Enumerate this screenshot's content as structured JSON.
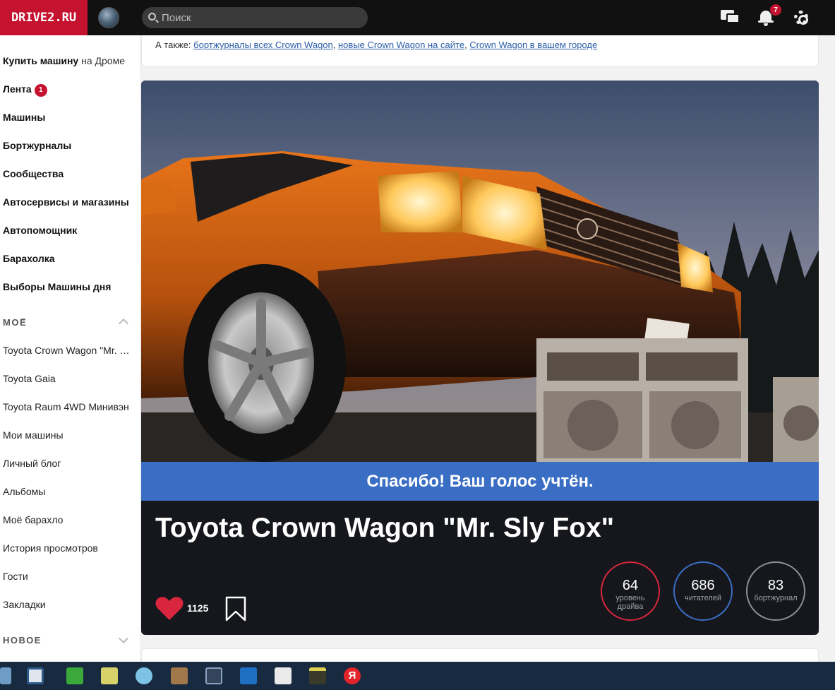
{
  "topbar": {
    "logo": "DRIVE2.RU",
    "search_placeholder": "Поиск",
    "notifications_count": "7"
  },
  "sidebar": {
    "main_nav": [
      {
        "label": "Купить машину",
        "suffix": " на Дроме"
      },
      {
        "label": "Лента",
        "badge": "1"
      },
      {
        "label": "Машины"
      },
      {
        "label": "Бортжурналы"
      },
      {
        "label": "Сообщества"
      },
      {
        "label": "Автосервисы и магазины"
      },
      {
        "label": "Автопомощник"
      },
      {
        "label": "Барахолка"
      },
      {
        "label": "Выборы Машины дня"
      }
    ],
    "my_section_title": "МОЁ",
    "my_items": [
      "Toyota Crown Wagon \"Mr. Sly Fox\"",
      "Toyota Gaia",
      "Toyota Raum 4WD Минивэн",
      "Мои машины",
      "Личный блог",
      "Альбомы",
      "Моё барахло",
      "История просмотров",
      "Гости",
      "Закладки"
    ],
    "new_section_title": "НОВОЕ"
  },
  "also": {
    "prefix": "А также: ",
    "links": [
      "бортжурналы всех Crown Wagon",
      "новые Crown Wagon на сайте",
      "Crown Wagon в вашем городе"
    ],
    "separator": ", "
  },
  "car": {
    "vote_message": "Спасибо! Ваш голос учтён.",
    "title": "Toyota Crown Wagon \"Mr. Sly Fox\"",
    "likes": "1125",
    "stats": [
      {
        "value": "64",
        "label": "уровень драйва",
        "color": "#d7263d"
      },
      {
        "value": "686",
        "label": "читателей",
        "color": "#3a6ec5"
      },
      {
        "value": "83",
        "label": "бортжурнал",
        "color": "#8a8f96"
      }
    ]
  },
  "colors": {
    "brand": "#c4122f",
    "accent_blue": "#3a6ec5",
    "heart": "#d7263d"
  },
  "taskbar": {
    "icons": [
      "calculator-icon",
      "network-app-icon",
      "green-app-icon",
      "ifix-prog-icon",
      "drone-app-icon",
      "chip-icon",
      "arrow-app-icon",
      "outlook-icon",
      "chart-doc-icon",
      "clapperboard-icon",
      "yandex-icon"
    ],
    "yandex_label": "Я"
  }
}
